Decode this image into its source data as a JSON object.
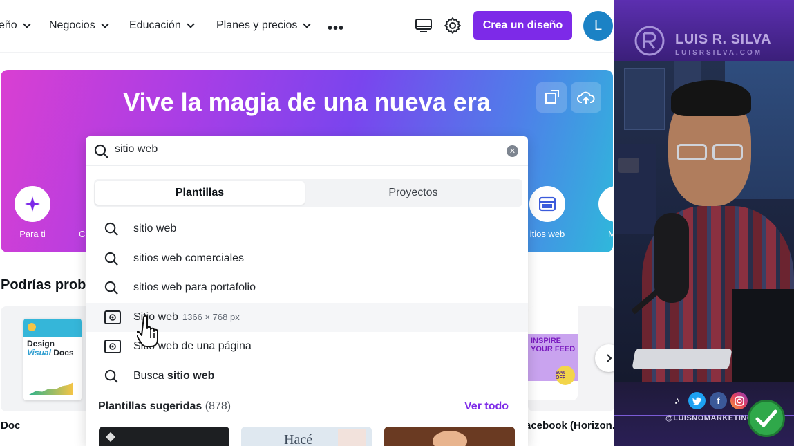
{
  "nav": {
    "items": [
      {
        "label": "eño"
      },
      {
        "label": "Negocios"
      },
      {
        "label": "Educación"
      },
      {
        "label": "Planes y precios"
      }
    ],
    "more_label": "•••",
    "create_button": "Crea un diseño",
    "avatar_letter": "L"
  },
  "hero": {
    "title": "Vive la magia de una nueva era",
    "categories": [
      {
        "label": "Para ti"
      },
      {
        "label": "C"
      },
      {
        "label": "itios web"
      },
      {
        "label": "M"
      }
    ]
  },
  "search": {
    "query": "sitio web",
    "tabs": [
      {
        "label": "Plantillas",
        "active": true
      },
      {
        "label": "Proyectos",
        "active": false
      }
    ],
    "suggestions": [
      {
        "icon": "search-icon",
        "text": "sitio web"
      },
      {
        "icon": "search-icon",
        "text": "sitios web comerciales"
      },
      {
        "icon": "search-icon",
        "text": "sitios web para portafolio"
      },
      {
        "icon": "website-icon",
        "text": "Sitio web",
        "dimensions": "1366 × 768 px"
      },
      {
        "icon": "website-icon",
        "text": "Sitio web de una página"
      },
      {
        "icon": "search-icon",
        "prefix": "Busca ",
        "bold": "sitio web"
      }
    ],
    "suggested_templates": {
      "title": "Plantillas sugeridas",
      "count": "(878)",
      "see_all": "Ver todo",
      "thumb_texts": [
        "Hacé"
      ]
    }
  },
  "main": {
    "section_title": "Podrías proba",
    "cards": [
      {
        "label": "Doc",
        "thumb_title": "Design",
        "thumb_sub": "Visual",
        "thumb_word": "Docs"
      },
      {
        "label": "acebook (Horizon...",
        "thumb_title": "INSPIRE YOUR FEED",
        "badge": "60% OFF"
      }
    ]
  },
  "streamer": {
    "brand": "LUIS R. SILVA",
    "url": "LUISRSILVA.COM",
    "handle": "@LUISNOMARKETING",
    "colors": {
      "accent": "#7d2ae8",
      "brand_bar": "#5c2fb0",
      "check": "#2fa84a"
    }
  }
}
